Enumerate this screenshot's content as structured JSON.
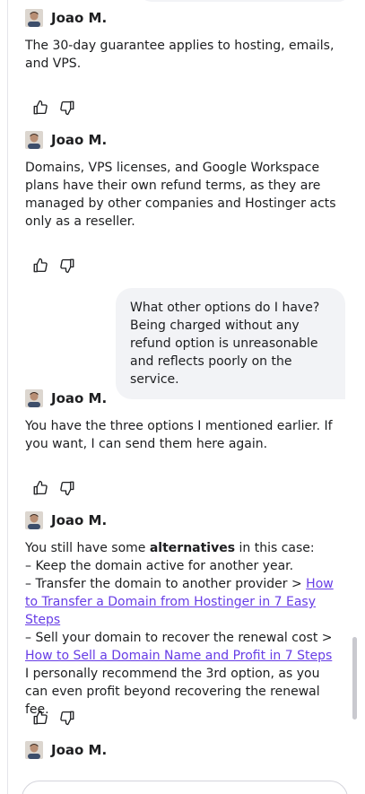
{
  "agent_name": "Joao M.",
  "messages": {
    "m1": "The 30-day guarantee applies to hosting, emails, and VPS.",
    "m2": "Domains, VPS licenses, and Google Workspace plans have their own refund terms, as they are managed by other companies and Hostinger acts only as a reseller.",
    "user1": "What other options do I have? Being charged without any refund option is unreasonable and reflects poorly on the service.",
    "m3": "You have the three options I mentioned earlier. If you want, I can send them here again.",
    "m4": {
      "intro_prefix": "You still have some ",
      "intro_bold": "alternatives",
      "intro_suffix": " in this case:",
      "line1": "– Keep the domain active for another year.",
      "line2_prefix": "– Transfer the domain to another provider > ",
      "line2_link": "How to Transfer a Domain from Hostinger in 7 Easy Steps",
      "line3_prefix": "– Sell your domain to recover the renewal cost > ",
      "line3_link": "How to Sell a Domain Name and Profit in 7 Steps",
      "line4": "I personally recommend the 3rd option, as you can even profit beyond recovering the renewal fee."
    }
  },
  "icons": {
    "thumbs_up": "thumbs-up-icon",
    "thumbs_down": "thumbs-down-icon",
    "avatar": "agent-avatar"
  },
  "colors": {
    "link": "#673de6",
    "user_bubble": "#f2f3f6",
    "text": "#1d1e20"
  }
}
